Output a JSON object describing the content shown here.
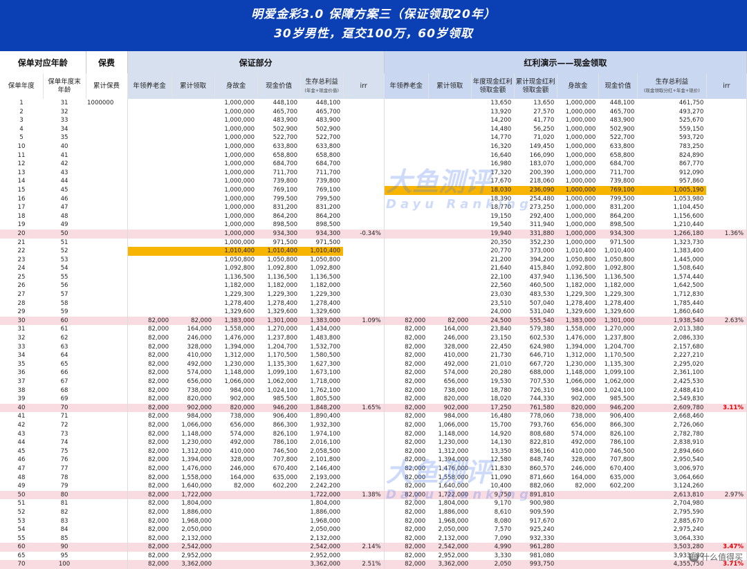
{
  "banner": {
    "title": "明爱金彩3.0  保障方案三（保证领取20年）",
    "subtitle": "30岁男性，趸交100万，60岁领取"
  },
  "headers": {
    "group_age": "保单对应年龄",
    "group_premium": "保费",
    "group_guarantee": "保证部分",
    "group_bonus": "红利演示——现金领取",
    "policy_year": "保单年度",
    "age_end": "保单年度末年龄",
    "cum_premium": "累计保费",
    "g_annuity": "年领养老金",
    "g_cum_recv": "累计领取",
    "g_death": "身故金",
    "g_cash": "现金价值",
    "g_survival": "生存总利益",
    "g_survival_sub": "(年金+现金价值)",
    "g_irr": "irr",
    "b_annuity": "年领养老金",
    "b_cum_recv": "累计领取",
    "b_div_annual": "年度现金红利领取金额",
    "b_div_cum": "累计现金红利领取金额",
    "b_death": "身故金",
    "b_cash": "现金价值",
    "b_survival": "生存总利益",
    "b_survival_sub": "(现金领取分红+年金+现价)",
    "b_irr": "irr"
  },
  "watermark": {
    "cn": "大鱼测评",
    "en": "Dayu Ranking"
  },
  "corner": {
    "icon": "zhi-icon",
    "text": "什么值得买"
  },
  "colors": {
    "banner": "#0b3fb4",
    "highlight": "#f7b400",
    "pink_row": "#f9dbe2",
    "irr_red": "#e00000"
  },
  "rows": [
    [
      "1",
      "31",
      "1000000",
      "",
      "",
      "1,000,000",
      "448,100",
      "448,100",
      "",
      "",
      "",
      "13,650",
      "13,650",
      "1,000,000",
      "448,100",
      "461,750",
      ""
    ],
    [
      "2",
      "32",
      "",
      "",
      "",
      "1,000,000",
      "465,700",
      "465,700",
      "",
      "",
      "",
      "13,920",
      "27,570",
      "1,000,000",
      "465,700",
      "493,270",
      ""
    ],
    [
      "3",
      "33",
      "",
      "",
      "",
      "1,000,000",
      "483,900",
      "483,900",
      "",
      "",
      "",
      "14,200",
      "41,770",
      "1,000,000",
      "483,900",
      "525,670",
      ""
    ],
    [
      "4",
      "34",
      "",
      "",
      "",
      "1,000,000",
      "502,900",
      "502,900",
      "",
      "",
      "",
      "14,480",
      "56,250",
      "1,000,000",
      "502,900",
      "559,150",
      ""
    ],
    [
      "5",
      "35",
      "",
      "",
      "",
      "1,000,000",
      "522,700",
      "522,700",
      "",
      "",
      "",
      "14,770",
      "71,020",
      "1,000,000",
      "522,700",
      "593,720",
      ""
    ],
    [
      "10",
      "40",
      "",
      "",
      "",
      "1,000,000",
      "633,800",
      "633,800",
      "",
      "",
      "",
      "16,320",
      "149,450",
      "1,000,000",
      "633,800",
      "783,250",
      ""
    ],
    [
      "11",
      "41",
      "",
      "",
      "",
      "1,000,000",
      "658,800",
      "658,800",
      "",
      "",
      "",
      "16,640",
      "166,090",
      "1,000,000",
      "658,800",
      "824,890",
      ""
    ],
    [
      "12",
      "42",
      "",
      "",
      "",
      "1,000,000",
      "684,700",
      "684,700",
      "",
      "",
      "",
      "16,980",
      "183,070",
      "1,000,000",
      "684,700",
      "867,770",
      ""
    ],
    [
      "13",
      "43",
      "",
      "",
      "",
      "1,000,000",
      "711,700",
      "711,700",
      "",
      "",
      "",
      "17,320",
      "200,390",
      "1,000,000",
      "711,700",
      "912,090",
      ""
    ],
    [
      "14",
      "44",
      "",
      "",
      "",
      "1,000,000",
      "739,800",
      "739,800",
      "",
      "",
      "",
      "17,670",
      "218,060",
      "1,000,000",
      "739,800",
      "957,860",
      ""
    ],
    [
      "15",
      "45",
      "",
      "",
      "",
      "1,000,000",
      "769,100",
      "769,100",
      "",
      "",
      "",
      "18,030",
      "236,090",
      "1,000,000",
      "769,100",
      "1,005,190",
      ""
    ],
    [
      "16",
      "46",
      "",
      "",
      "",
      "1,000,000",
      "799,500",
      "799,500",
      "",
      "",
      "",
      "18,390",
      "254,480",
      "1,000,000",
      "799,500",
      "1,053,980",
      ""
    ],
    [
      "17",
      "47",
      "",
      "",
      "",
      "1,000,000",
      "831,200",
      "831,200",
      "",
      "",
      "",
      "18,770",
      "273,250",
      "1,000,000",
      "831,200",
      "1,104,450",
      ""
    ],
    [
      "18",
      "48",
      "",
      "",
      "",
      "1,000,000",
      "864,200",
      "864,200",
      "",
      "",
      "",
      "19,150",
      "292,400",
      "1,000,000",
      "864,200",
      "1,156,600",
      ""
    ],
    [
      "19",
      "49",
      "",
      "",
      "",
      "1,000,000",
      "898,500",
      "898,500",
      "",
      "",
      "",
      "19,540",
      "311,940",
      "1,000,000",
      "898,500",
      "1,210,440",
      ""
    ],
    [
      "20",
      "50",
      "",
      "",
      "",
      "1,000,000",
      "934,300",
      "934,300",
      "-0.34%",
      "",
      "",
      "19,940",
      "331,880",
      "1,000,000",
      "934,300",
      "1,266,180",
      "1.36%"
    ],
    [
      "21",
      "51",
      "",
      "",
      "",
      "1,000,000",
      "971,500",
      "971,500",
      "",
      "",
      "",
      "20,350",
      "352,230",
      "1,000,000",
      "971,500",
      "1,323,730",
      ""
    ],
    [
      "22",
      "52",
      "",
      "",
      "",
      "1,010,400",
      "1,010,400",
      "1,010,400",
      "",
      "",
      "",
      "20,770",
      "373,000",
      "1,010,400",
      "1,010,400",
      "1,383,400",
      ""
    ],
    [
      "23",
      "53",
      "",
      "",
      "",
      "1,050,800",
      "1,050,800",
      "1,050,800",
      "",
      "",
      "",
      "21,200",
      "394,200",
      "1,050,800",
      "1,050,800",
      "1,445,000",
      ""
    ],
    [
      "24",
      "54",
      "",
      "",
      "",
      "1,092,800",
      "1,092,800",
      "1,092,800",
      "",
      "",
      "",
      "21,640",
      "415,840",
      "1,092,800",
      "1,092,800",
      "1,508,640",
      ""
    ],
    [
      "25",
      "55",
      "",
      "",
      "",
      "1,136,500",
      "1,136,500",
      "1,136,500",
      "",
      "",
      "",
      "22,100",
      "437,940",
      "1,136,500",
      "1,136,500",
      "1,574,440",
      ""
    ],
    [
      "26",
      "56",
      "",
      "",
      "",
      "1,182,000",
      "1,182,000",
      "1,182,000",
      "",
      "",
      "",
      "22,560",
      "460,500",
      "1,182,000",
      "1,182,000",
      "1,642,500",
      ""
    ],
    [
      "27",
      "57",
      "",
      "",
      "",
      "1,229,300",
      "1,229,300",
      "1,229,300",
      "",
      "",
      "",
      "23,030",
      "483,530",
      "1,229,300",
      "1,229,300",
      "1,712,830",
      ""
    ],
    [
      "28",
      "58",
      "",
      "",
      "",
      "1,278,400",
      "1,278,400",
      "1,278,400",
      "",
      "",
      "",
      "23,510",
      "507,040",
      "1,278,400",
      "1,278,400",
      "1,785,440",
      ""
    ],
    [
      "29",
      "59",
      "",
      "",
      "",
      "1,329,600",
      "1,329,600",
      "1,329,600",
      "",
      "",
      "",
      "24,000",
      "531,040",
      "1,329,600",
      "1,329,600",
      "1,860,640",
      ""
    ],
    [
      "30",
      "60",
      "",
      "82,000",
      "82,000",
      "1,383,000",
      "1,301,000",
      "1,383,000",
      "1.09%",
      "82,000",
      "82,000",
      "24,500",
      "555,540",
      "1,383,000",
      "1,301,000",
      "1,938,540",
      "2.63%"
    ],
    [
      "31",
      "61",
      "",
      "82,000",
      "164,000",
      "1,558,000",
      "1,270,000",
      "1,434,000",
      "",
      "82,000",
      "164,000",
      "23,840",
      "579,380",
      "1,558,000",
      "1,270,000",
      "2,013,380",
      ""
    ],
    [
      "32",
      "62",
      "",
      "82,000",
      "246,000",
      "1,476,000",
      "1,237,800",
      "1,483,800",
      "",
      "82,000",
      "246,000",
      "23,150",
      "602,530",
      "1,476,000",
      "1,237,800",
      "2,086,330",
      ""
    ],
    [
      "33",
      "63",
      "",
      "82,000",
      "328,000",
      "1,394,000",
      "1,204,700",
      "1,532,700",
      "",
      "82,000",
      "328,000",
      "22,450",
      "624,980",
      "1,394,000",
      "1,204,700",
      "2,157,680",
      ""
    ],
    [
      "34",
      "64",
      "",
      "82,000",
      "410,000",
      "1,312,000",
      "1,170,500",
      "1,580,500",
      "",
      "82,000",
      "410,000",
      "21,730",
      "646,710",
      "1,312,000",
      "1,170,500",
      "2,227,210",
      ""
    ],
    [
      "35",
      "65",
      "",
      "82,000",
      "492,000",
      "1,230,000",
      "1,135,300",
      "1,627,300",
      "",
      "82,000",
      "492,000",
      "21,010",
      "667,720",
      "1,230,000",
      "1,135,300",
      "2,295,020",
      ""
    ],
    [
      "36",
      "66",
      "",
      "82,000",
      "574,000",
      "1,148,000",
      "1,099,100",
      "1,673,100",
      "",
      "82,000",
      "574,000",
      "20,280",
      "688,000",
      "1,148,000",
      "1,099,100",
      "2,361,100",
      ""
    ],
    [
      "37",
      "67",
      "",
      "82,000",
      "656,000",
      "1,066,000",
      "1,062,000",
      "1,718,000",
      "",
      "82,000",
      "656,000",
      "19,530",
      "707,530",
      "1,066,000",
      "1,062,000",
      "2,425,530",
      ""
    ],
    [
      "38",
      "68",
      "",
      "82,000",
      "738,000",
      "984,000",
      "1,024,100",
      "1,762,100",
      "",
      "82,000",
      "738,000",
      "18,780",
      "726,310",
      "984,000",
      "1,024,100",
      "2,488,410",
      ""
    ],
    [
      "39",
      "69",
      "",
      "82,000",
      "820,000",
      "902,000",
      "985,500",
      "1,805,500",
      "",
      "82,000",
      "820,000",
      "18,020",
      "744,330",
      "902,000",
      "985,500",
      "2,549,830",
      ""
    ],
    [
      "40",
      "70",
      "",
      "82,000",
      "902,000",
      "820,000",
      "946,200",
      "1,848,200",
      "1.65%",
      "82,000",
      "902,000",
      "17,250",
      "761,580",
      "820,000",
      "946,200",
      "2,609,780",
      "3.11%"
    ],
    [
      "41",
      "71",
      "",
      "82,000",
      "984,000",
      "738,000",
      "906,400",
      "1,890,400",
      "",
      "82,000",
      "984,000",
      "16,480",
      "778,060",
      "738,000",
      "906,400",
      "2,668,460",
      ""
    ],
    [
      "42",
      "72",
      "",
      "82,000",
      "1,066,000",
      "656,000",
      "866,300",
      "1,932,300",
      "",
      "82,000",
      "1,066,000",
      "15,700",
      "793,760",
      "656,000",
      "866,300",
      "2,726,060",
      ""
    ],
    [
      "43",
      "73",
      "",
      "82,000",
      "1,148,000",
      "574,000",
      "826,100",
      "1,974,100",
      "",
      "82,000",
      "1,148,000",
      "14,920",
      "808,680",
      "574,000",
      "826,100",
      "2,782,780",
      ""
    ],
    [
      "44",
      "74",
      "",
      "82,000",
      "1,230,000",
      "492,000",
      "786,100",
      "2,016,100",
      "",
      "82,000",
      "1,230,000",
      "14,130",
      "822,810",
      "492,000",
      "786,100",
      "2,838,910",
      ""
    ],
    [
      "45",
      "75",
      "",
      "82,000",
      "1,312,000",
      "410,000",
      "746,500",
      "2,058,500",
      "",
      "82,000",
      "1,312,000",
      "13,350",
      "836,160",
      "410,000",
      "746,500",
      "2,894,660",
      ""
    ],
    [
      "46",
      "76",
      "",
      "82,000",
      "1,394,000",
      "328,000",
      "707,800",
      "2,101,800",
      "",
      "82,000",
      "1,394,000",
      "12,580",
      "848,740",
      "328,000",
      "707,800",
      "2,950,540",
      ""
    ],
    [
      "47",
      "77",
      "",
      "82,000",
      "1,476,000",
      "246,000",
      "670,400",
      "2,146,400",
      "",
      "82,000",
      "1,476,000",
      "11,830",
      "860,570",
      "246,000",
      "670,400",
      "3,006,970",
      ""
    ],
    [
      "48",
      "78",
      "",
      "82,000",
      "1,558,000",
      "164,000",
      "635,000",
      "2,193,000",
      "",
      "82,000",
      "1,558,000",
      "11,090",
      "871,660",
      "164,000",
      "635,000",
      "3,064,660",
      ""
    ],
    [
      "49",
      "79",
      "",
      "82,000",
      "1,640,000",
      "82,000",
      "602,200",
      "2,242,200",
      "",
      "82,000",
      "1,640,000",
      "10,400",
      "882,060",
      "82,000",
      "602,200",
      "3,124,260",
      ""
    ],
    [
      "50",
      "80",
      "",
      "82,000",
      "1,722,000",
      "",
      "",
      "1,722,000",
      "1.38%",
      "82,000",
      "1,722,000",
      "9,750",
      "891,810",
      "",
      "",
      "2,613,810",
      "2.97%"
    ],
    [
      "51",
      "81",
      "",
      "82,000",
      "1,804,000",
      "",
      "",
      "1,804,000",
      "",
      "82,000",
      "1,804,000",
      "9,170",
      "900,980",
      "",
      "",
      "2,704,980",
      ""
    ],
    [
      "52",
      "82",
      "",
      "82,000",
      "1,886,000",
      "",
      "",
      "1,886,000",
      "",
      "82,000",
      "1,886,000",
      "8,610",
      "909,590",
      "",
      "",
      "2,795,590",
      ""
    ],
    [
      "53",
      "83",
      "",
      "82,000",
      "1,968,000",
      "",
      "",
      "1,968,000",
      "",
      "82,000",
      "1,968,000",
      "8,080",
      "917,670",
      "",
      "",
      "2,885,670",
      ""
    ],
    [
      "54",
      "84",
      "",
      "82,000",
      "2,050,000",
      "",
      "",
      "2,050,000",
      "",
      "82,000",
      "2,050,000",
      "7,570",
      "925,240",
      "",
      "",
      "2,975,240",
      ""
    ],
    [
      "55",
      "85",
      "",
      "82,000",
      "2,132,000",
      "",
      "",
      "2,132,000",
      "",
      "82,000",
      "2,132,000",
      "7,090",
      "932,330",
      "",
      "",
      "3,064,330",
      ""
    ],
    [
      "60",
      "90",
      "",
      "82,000",
      "2,542,000",
      "",
      "",
      "2,542,000",
      "2.14%",
      "82,000",
      "2,542,000",
      "4,990",
      "961,280",
      "",
      "",
      "3,503,280",
      "3.47%"
    ],
    [
      "65",
      "95",
      "",
      "82,000",
      "2,952,000",
      "",
      "",
      "2,952,000",
      "",
      "82,000",
      "2,952,000",
      "3,330",
      "981,080",
      "",
      "",
      "3,933,080",
      ""
    ],
    [
      "70",
      "100",
      "",
      "82,000",
      "3,362,000",
      "",
      "",
      "3,362,000",
      "2.51%",
      "82,000",
      "3,362,000",
      "2,050",
      "993,750",
      "",
      "",
      "4,355,750",
      "3.71%"
    ]
  ]
}
